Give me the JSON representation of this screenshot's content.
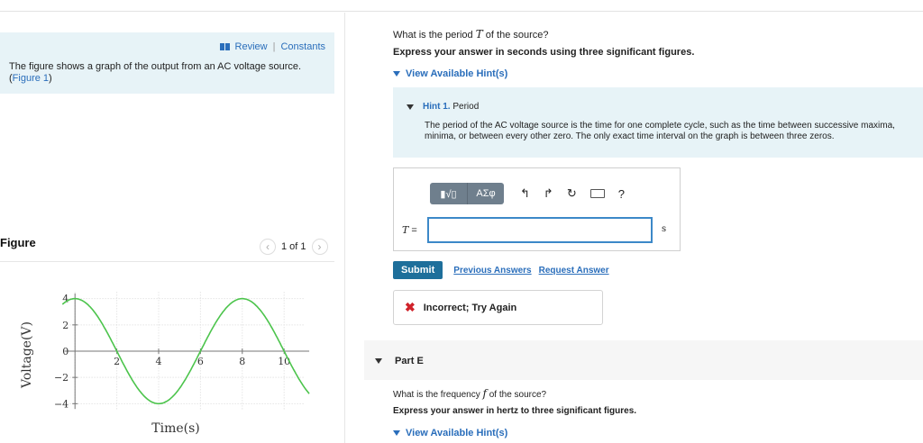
{
  "left": {
    "review_label": "Review",
    "separator": "|",
    "constants_label": "Constants",
    "intro_text": "The figure shows a graph of the output from an AC voltage source. (",
    "figure_link": "Figure 1",
    "intro_close": ")",
    "figure_title": "Figure",
    "pager_text": "1 of 1",
    "pager_prev": "‹",
    "pager_next": "›"
  },
  "chart_data": {
    "type": "line",
    "xlabel": "Time(s)",
    "ylabel": "Voltage(V)",
    "xlim": [
      -1,
      11.5
    ],
    "ylim": [
      -4.8,
      4.8
    ],
    "xticks": [
      2,
      4,
      6,
      8,
      10
    ],
    "yticks": [
      4,
      2,
      0,
      -2,
      -4
    ],
    "ytick_labels": [
      "4",
      "2",
      "0",
      "−2",
      "−4"
    ],
    "grid": true,
    "series": [
      {
        "function": "sine",
        "amplitude": 4,
        "period": 8,
        "zero_crossing": 2,
        "x_start": -0.6,
        "x_end": 11.2,
        "color": "#4cc44c"
      }
    ]
  },
  "question": {
    "text_pre": "What is the period",
    "symbol": "T",
    "text_post": "of the source?",
    "instruction": "Express your answer in seconds using three significant figures.",
    "hint_toggle": "View Available Hint(s)"
  },
  "hint": {
    "number_label": "Hint 1.",
    "title": "Period",
    "body": "The period of the AC voltage source is the time for one complete cycle, such as the time between successive maxima, minima, or between every other zero.  The only exact time interval on the graph is between three zeros."
  },
  "answer": {
    "templates_label": "▮√▯",
    "greek_label": "ΑΣφ",
    "undo_icon": "↰",
    "redo_icon": "↱",
    "reset_icon": "↻",
    "help_label": "?",
    "var_label": "T",
    "equals": "=",
    "value": "",
    "unit": "s"
  },
  "actions": {
    "submit": "Submit",
    "previous": "Previous Answers",
    "request": "Request Answer"
  },
  "feedback": {
    "icon": "✖",
    "text": "Incorrect; Try Again"
  },
  "part_e": {
    "label": "Part E",
    "q_pre": "What is the frequency",
    "symbol": "f",
    "q_post": "of the source?",
    "instruction": "Express your answer in hertz to three significant figures.",
    "hint_toggle": "View Available Hint(s)"
  }
}
